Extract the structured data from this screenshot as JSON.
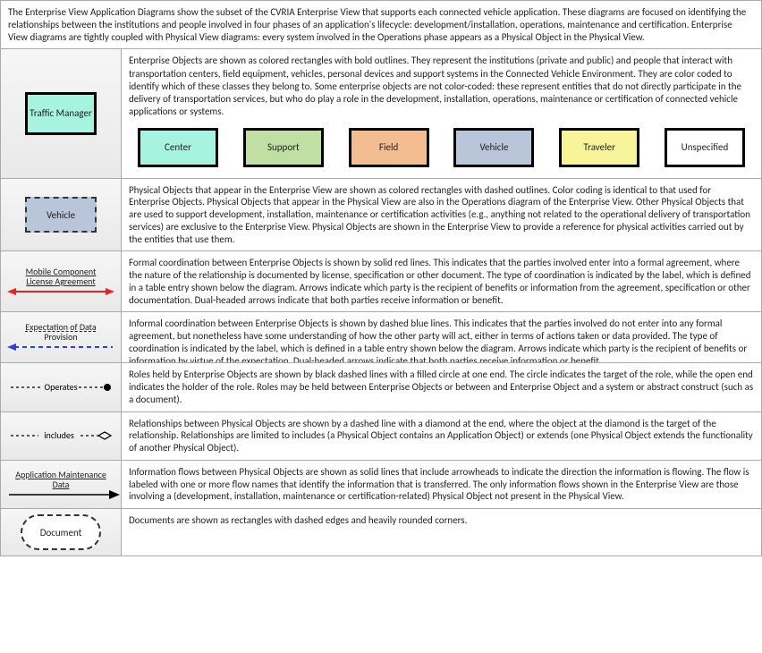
{
  "intro": "The Enterprise View Application Diagrams show the subset of the CVRIA Enterprise View that supports each connected vehicle application.  These diagrams are focused on identifying the relationships between the institutions and people involved in four phases of an application's lifecycle: development/installation, operations, maintenance and certification. Enterprise View diagrams are tightly coupled with Physical View diagrams: every system involved in the Operations phase appears as a Physical Object in the Physical View.",
  "rows": {
    "enterprise_objects": {
      "icon_label": "Traffic Manager",
      "desc": "Enterprise Objects are shown as colored rectangles with bold outlines.  They represent the institutions (private and public) and people that interact with transportation centers, field equipment, vehicles, personal devices and support systems  in the Connected Vehicle Environment. They are color coded to identify which of these classes they belong to.  Some enterprise objects are not color-coded: these represent entities that do not directly participate in the delivery of transportation services, but who do play a role in the development, installation, operations, maintenance or certification of connected vehicle applications or systems.",
      "legend": [
        {
          "label": "Center",
          "color": "#a6f3df"
        },
        {
          "label": "Support",
          "color": "#c0dfa2"
        },
        {
          "label": "Field",
          "color": "#f4bd91"
        },
        {
          "label": "Vehicle",
          "color": "#b9c6d9"
        },
        {
          "label": "Traveler",
          "color": "#f7f49a"
        },
        {
          "label": "Unspecified",
          "color": "#ffffff"
        }
      ]
    },
    "physical_objects": {
      "icon_label": "Vehicle",
      "desc": "Physical Objects that appear in the Enterprise View are shown as colored rectangles with dashed outlines. Color coding is identical to that used for Enterprise Objects. Physical Objects that appear in the Physical View are also in the Operations diagram of the Enterprise View. Other Physical Objects that are used to support development, installation, maintenance or certification activities (e.g., anything not related to the operational delivery of transportation services) are exclusive to the Enterprise View. Physical Objects are shown in the Enterprise View to provide a reference for physical activities carried out by the entities that use them."
    },
    "formal": {
      "icon_label_top": "Mobile Component",
      "icon_label_bottom": "License Agreement",
      "desc": "Formal coordination between Enterprise Objects is shown by solid red lines. This indicates that the parties involved enter into a formal agreement, where the nature of the relationship is documented by license, specification or other document. The type of coordination is indicated by the label, which is defined in a table entry shown below the diagram. Arrows indicate which party is the recipient of benefits or information from the agreement, specification or other documentation. Dual-headed arrows indicate that both parties receive information or benefit."
    },
    "informal": {
      "icon_label_top": "Expectation of Data",
      "icon_label_bottom": "Provision",
      "desc": "Informal coordination between Enterprise Objects is shown by dashed blue lines. This indicates that the parties involved do not enter into any formal agreement, but nonetheless have some understanding of how the other party will act, either in terms of actions taken or data provided. The type of coordination is indicated by the label, which is defined in a table entry shown below the diagram. Arrows indicate which party is the recipient of benefits or information by virtue of the expectation. Dual-headed arrows indicate that both parties receive information or benefit."
    },
    "roles": {
      "icon_label": "Operates",
      "desc": "Roles held by Enterprise Objects are shown by black dashed lines with a filled circle at one end. The circle indicates the target of the role, while the open end indicates the holder of the role. Roles may be held between Enterprise Objects or between and Enterprise Object and a system or abstract construct (such as a document)."
    },
    "includes": {
      "icon_label": "includes",
      "desc": "Relationships between Physical Objects are shown by a dashed line with a diamond at the end, where the object at the diamond is the target of the relationship. Relationships are limited to includes (a Physical Object contains an Application Object) or extends (one Physical Object extends the functionality of another Physical Object)."
    },
    "flow": {
      "icon_label_top": "Application Maintenance",
      "icon_label_bottom": "Data",
      "desc": "Information flows between Physical Objects are shown as solid lines that include arrowheads to indicate the direction the information is flowing.  The flow is labeled with one or more flow names that identify the information that is transferred.  The only information flows shown in the Enterprise View are those involving a (development, installation, maintenance or certification-related) Physical Object not present in the Physical View."
    },
    "document": {
      "icon_label": "Document",
      "desc": "Documents are shown as rectangles with dashed edges and heavily rounded corners."
    }
  }
}
